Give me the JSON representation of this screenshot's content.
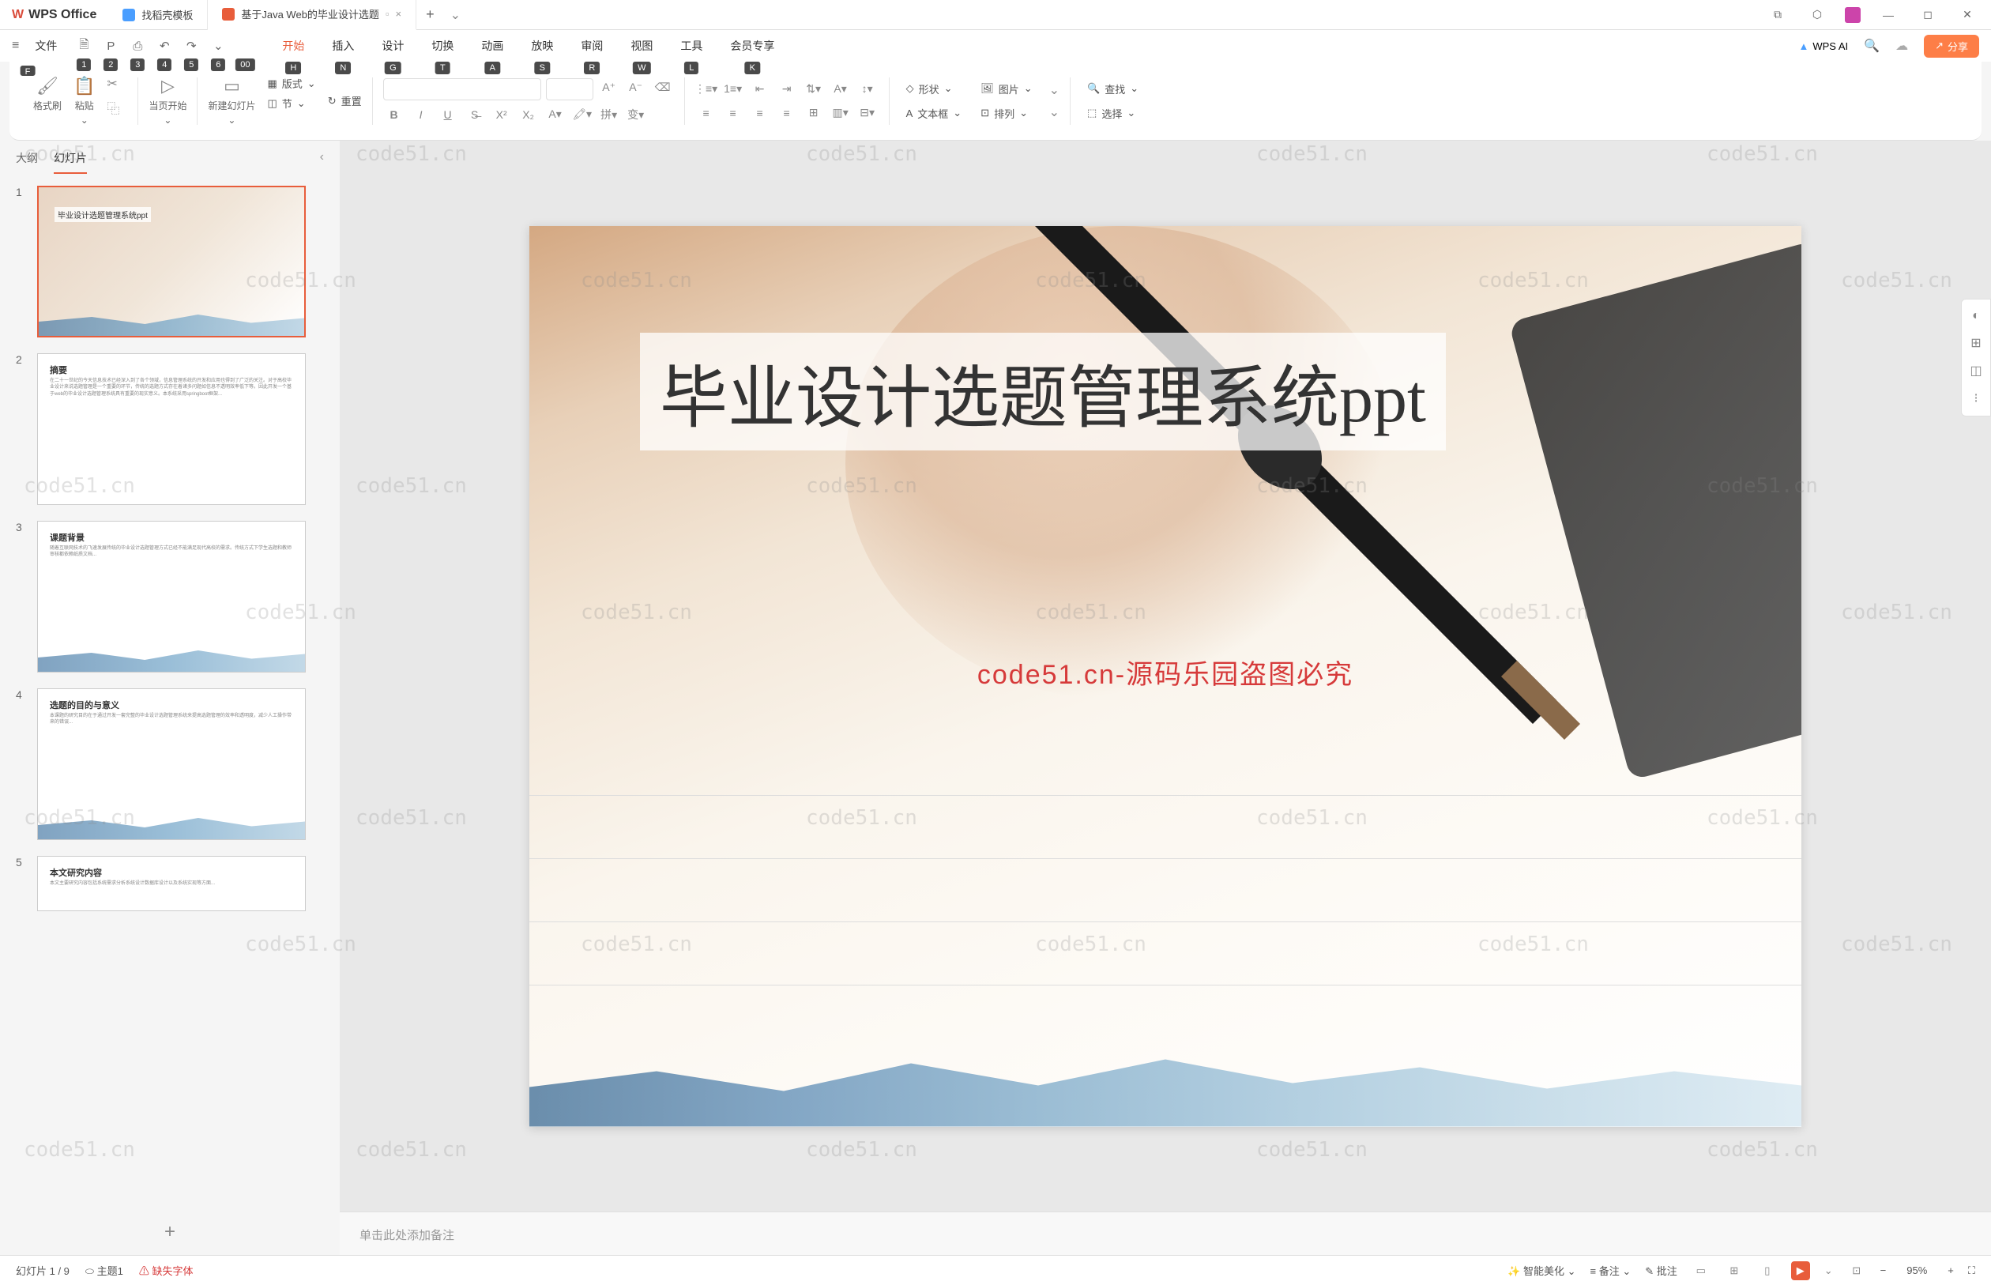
{
  "app": {
    "name": "WPS Office",
    "tabs": [
      {
        "label": "找稻壳模板",
        "type": "template"
      },
      {
        "label": "基于Java Web的毕业设计选题",
        "type": "ppt",
        "active": true
      }
    ]
  },
  "menu": {
    "file": "文件",
    "key_hints": [
      "F",
      "1",
      "2",
      "3",
      "4",
      "5",
      "6",
      "00"
    ],
    "tabs": [
      {
        "label": "开始",
        "key": "H",
        "active": true
      },
      {
        "label": "插入",
        "key": "N"
      },
      {
        "label": "设计",
        "key": "G"
      },
      {
        "label": "切换",
        "key": "T"
      },
      {
        "label": "动画",
        "key": "A"
      },
      {
        "label": "放映",
        "key": "S"
      },
      {
        "label": "审阅",
        "key": "R"
      },
      {
        "label": "视图",
        "key": "W"
      },
      {
        "label": "工具",
        "key": "L"
      },
      {
        "label": "会员专享",
        "key": "K"
      }
    ],
    "wps_ai": "WPS AI",
    "share": "分享"
  },
  "ribbon": {
    "format_brush": "格式刷",
    "paste": "粘贴",
    "current_start": "当页开始",
    "new_slide": "新建幻灯片",
    "format": "版式",
    "section": "节",
    "reset": "重置",
    "shape": "形状",
    "image": "图片",
    "textbox": "文本框",
    "arrange": "排列",
    "find": "查找",
    "select": "选择"
  },
  "panel": {
    "outline": "大纲",
    "slides": "幻灯片"
  },
  "thumbnails": [
    {
      "num": "1",
      "title": "毕业设计选题管理系统ppt",
      "selected": true,
      "type": "cover"
    },
    {
      "num": "2",
      "title": "摘要",
      "type": "text"
    },
    {
      "num": "3",
      "title": "课题背景",
      "type": "text"
    },
    {
      "num": "4",
      "title": "选题的目的与意义",
      "type": "text"
    },
    {
      "num": "5",
      "title": "本文研究内容",
      "type": "text"
    }
  ],
  "slide": {
    "title": "毕业设计选题管理系统ppt",
    "watermark_center": "code51.cn-源码乐园盗图必究"
  },
  "notes": {
    "placeholder": "单击此处添加备注"
  },
  "statusbar": {
    "slide_info": "幻灯片 1 / 9",
    "theme": "主题1",
    "missing_font": "缺失字体",
    "smart_beautify": "智能美化",
    "notes_btn": "备注",
    "comments": "批注",
    "zoom": "95%"
  },
  "watermark": "code51.cn"
}
